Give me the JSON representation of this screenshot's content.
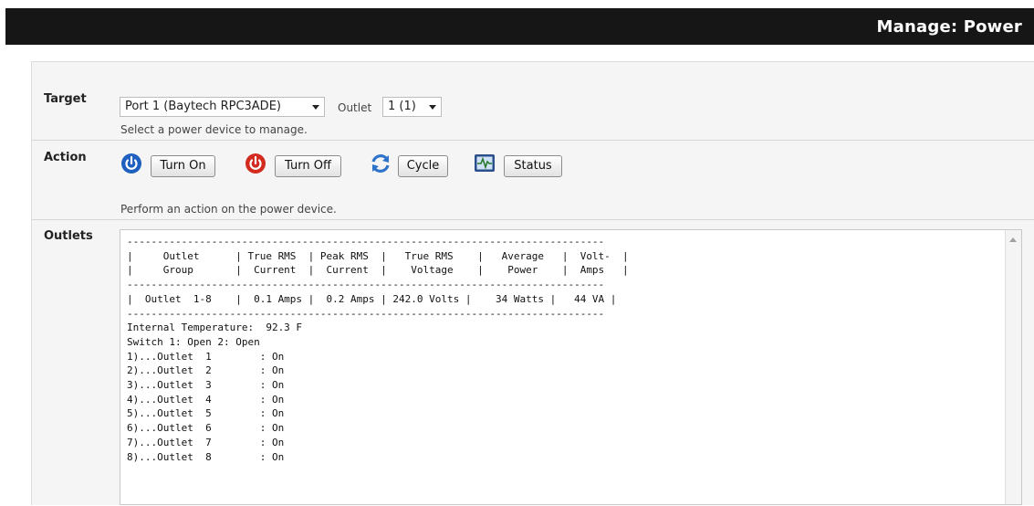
{
  "header": {
    "title": "Manage: Power"
  },
  "target": {
    "label": "Target",
    "device_value": "Port 1 (Baytech RPC3ADE)",
    "outlet_label": "Outlet",
    "outlet_value": "1 (1)",
    "hint": "Select a power device to manage."
  },
  "action": {
    "label": "Action",
    "turn_on": "Turn On",
    "turn_off": "Turn Off",
    "cycle": "Cycle",
    "status": "Status",
    "hint": "Perform an action on the power device.",
    "icons": {
      "on": "power-icon",
      "off": "power-off-icon",
      "cycle": "cycle-icon",
      "status": "status-monitor-icon"
    },
    "colors": {
      "on": "#1f5fbf",
      "off": "#d32a1f",
      "cycle": "#2e73c9",
      "status": "#2a4f8a"
    }
  },
  "outlets": {
    "label": "Outlets",
    "lines": [
      "-------------------------------------------------------------------------------",
      "|     Outlet      | True RMS  | Peak RMS  |   True RMS    |   Average   |  Volt-  |",
      "|     Group       |  Current  |  Current  |    Voltage    |    Power    |  Amps   |",
      "-------------------------------------------------------------------------------",
      "|  Outlet  1-8    |  0.1 Amps |  0.2 Amps | 242.0 Volts |    34 Watts |   44 VA |",
      "-------------------------------------------------------------------------------",
      "Internal Temperature:  92.3 F",
      "Switch 1: Open 2: Open",
      "1)...Outlet  1        : On",
      "2)...Outlet  2        : On",
      "3)...Outlet  3        : On",
      "4)...Outlet  4        : On",
      "5)...Outlet  5        : On",
      "6)...Outlet  6        : On",
      "7)...Outlet  7        : On",
      "8)...Outlet  8        : On"
    ]
  }
}
